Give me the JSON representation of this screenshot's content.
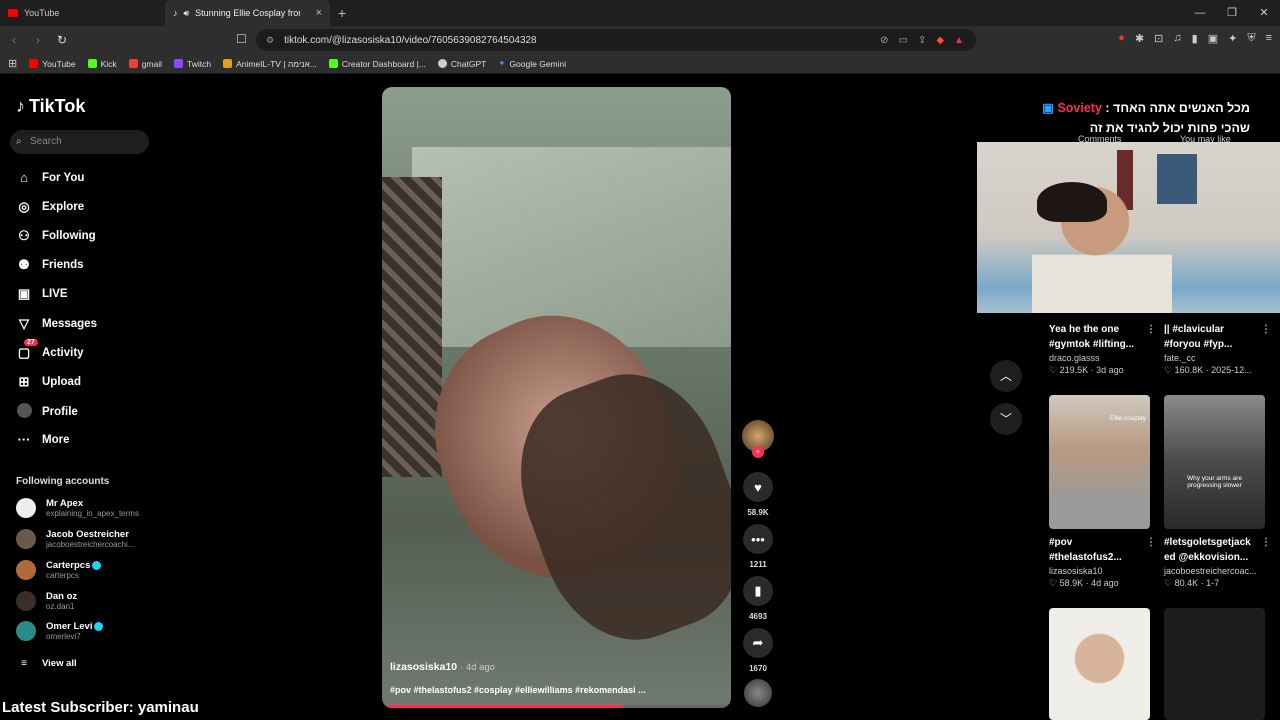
{
  "browser": {
    "tabs": [
      {
        "label": "YouTube",
        "color": "#ff0000"
      },
      {
        "label": "Stunning Ellie Cosplay from T",
        "color": "#ffffff"
      }
    ],
    "url": "tiktok.com/@lizasosiska10/video/7605639082764504328",
    "bookmarks": [
      {
        "label": "YouTube",
        "color": "#ff0000"
      },
      {
        "label": "Kick",
        "color": "#53fc18"
      },
      {
        "label": "gmail",
        "color": "#ea4335"
      },
      {
        "label": "Twitch",
        "color": "#9146ff"
      },
      {
        "label": "AnimeIL-TV | אנימה...",
        "color": "#e0a020"
      },
      {
        "label": "Creator Dashboard |...",
        "color": "#53fc18"
      },
      {
        "label": "ChatGPT",
        "color": "#cccccc"
      },
      {
        "label": "Google Gemini",
        "color": "#4a8cff"
      }
    ]
  },
  "tiktok": {
    "logo": "TikTok",
    "search_placeholder": "Search",
    "nav": [
      {
        "label": "For You",
        "icon": "home-icon"
      },
      {
        "label": "Explore",
        "icon": "compass-icon"
      },
      {
        "label": "Following",
        "icon": "following-icon"
      },
      {
        "label": "Friends",
        "icon": "friends-icon"
      },
      {
        "label": "LIVE",
        "icon": "live-icon"
      },
      {
        "label": "Messages",
        "icon": "messages-icon"
      },
      {
        "label": "Activity",
        "icon": "activity-icon",
        "badge": "27"
      },
      {
        "label": "Upload",
        "icon": "upload-icon"
      },
      {
        "label": "Profile",
        "icon": "profile-icon"
      },
      {
        "label": "More",
        "icon": "more-icon"
      }
    ],
    "following_title": "Following accounts",
    "accounts": [
      {
        "name": "Mr Apex",
        "handle": "explaining_in_apex_terms",
        "verified": false
      },
      {
        "name": "Jacob Oestreicher",
        "handle": "jacoboestreichercoachi...",
        "verified": false
      },
      {
        "name": "Carterpcs",
        "handle": "carterpcs",
        "verified": true
      },
      {
        "name": "Dan oz",
        "handle": "oz.dan1",
        "verified": false
      },
      {
        "name": "Omer Levi",
        "handle": "omerlevi7",
        "verified": true
      }
    ],
    "view_all": "View all",
    "video": {
      "author": "lizasosiska10",
      "ago": "· 4d ago",
      "caption": "#pov #thelastofus2 #cosplay #elliewilliams #rekomendasi ...",
      "progress_percent": 69
    },
    "actions": {
      "likes": "58.9K",
      "comments": "1211",
      "saves": "4693",
      "shares": "1670"
    },
    "panel_tabs": {
      "comments": "Comments",
      "you_may_like": "You may like"
    },
    "recommendations": [
      {
        "title1": "Yea he the one",
        "title2": "#gymtok #lifting...",
        "author": "draco.glasss",
        "stats": "♡ 219.5K · 3d ago"
      },
      {
        "title1": "|| #clavicular",
        "title2": "#foryou #fyp...",
        "author": "fate._cc",
        "stats": "♡ 160.8K · 2025-12..."
      },
      {
        "title1": "#pov",
        "title2": "#thelastofus2...",
        "author": "lizasosiska10",
        "stats": "♡ 58.9K · 4d ago",
        "thumb_text": "Ellie cosplay"
      },
      {
        "title1": "#letsgoletsgetjack",
        "title2": "ed @ekkovision...",
        "author": "jacoboestreichercoac...",
        "stats": "♡ 80.4K · 1-7",
        "thumb_text": "Why your arms are progressing slower"
      }
    ]
  },
  "stream": {
    "overlay_line1_prefix": "מכל האנשים אתה האחד :",
    "overlay_brand": "Sovіety",
    "overlay_line2": "שהכי פחות יכול להגיד את זה",
    "latest_subscriber": "Latest Subscriber: yaminau"
  }
}
